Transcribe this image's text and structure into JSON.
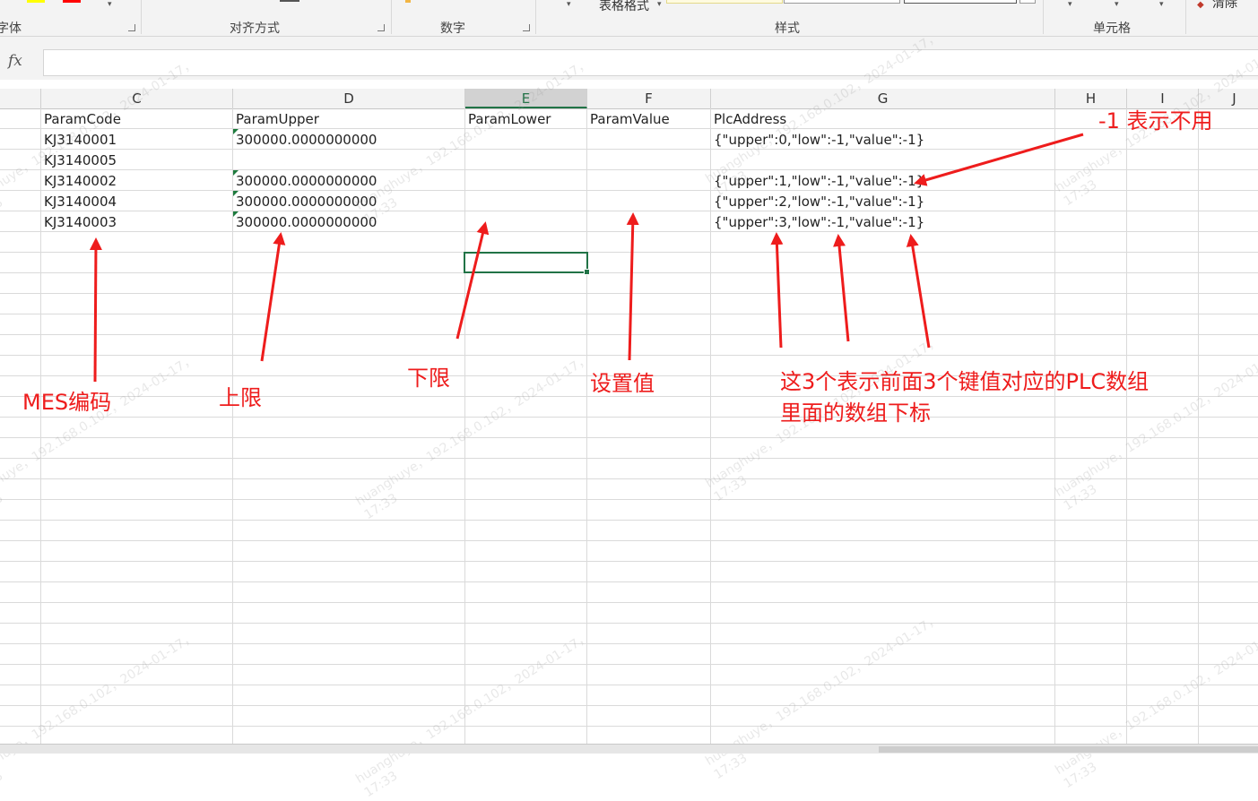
{
  "ribbon": {
    "groups": [
      {
        "label": "字体"
      },
      {
        "label": "对齐方式"
      },
      {
        "label": "数字"
      },
      {
        "label": "样式"
      },
      {
        "label": "单元格"
      }
    ],
    "table_format_label": "表格格式",
    "clear_label": "清除",
    "colors": {
      "highlight": "#ffff00",
      "font": "#ff0000",
      "accent": "#217346"
    }
  },
  "formula_bar": {
    "fx_label": "fx",
    "value": ""
  },
  "columns": [
    {
      "letter": "C"
    },
    {
      "letter": "D"
    },
    {
      "letter": "E"
    },
    {
      "letter": "F"
    },
    {
      "letter": "G"
    },
    {
      "letter": "H"
    },
    {
      "letter": "I"
    },
    {
      "letter": "J"
    }
  ],
  "selected_column": "E",
  "table": {
    "headers": [
      "ParamCode",
      "ParamUpper",
      "ParamLower",
      "ParamValue",
      "PlcAddress"
    ],
    "rows": [
      [
        "KJ3140001",
        "300000.0000000000",
        "",
        "",
        "{\"upper\":0,\"low\":-1,\"value\":-1}"
      ],
      [
        "KJ3140005",
        "",
        "",
        "",
        ""
      ],
      [
        "KJ3140002",
        "300000.0000000000",
        "",
        "",
        "{\"upper\":1,\"low\":-1,\"value\":-1}"
      ],
      [
        "KJ3140004",
        "300000.0000000000",
        "",
        "",
        "{\"upper\":2,\"low\":-1,\"value\":-1}"
      ],
      [
        "KJ3140003",
        "300000.0000000000",
        "",
        "",
        "{\"upper\":3,\"low\":-1,\"value\":-1}"
      ]
    ]
  },
  "annotations": {
    "mes_code": "MES编码",
    "upper": "上限",
    "lower": "下限",
    "set_value": "设置值",
    "minus_one": "-1 表示不用",
    "plc_note_line1": "这3个表示前面3个键值对应的PLC数组",
    "plc_note_line2": "里面的数组下标",
    "color": "#ee1c1c"
  },
  "watermark": {
    "line1": "huanghuye，192.168.0.102，2024-01-17，",
    "line2": "17:33"
  }
}
